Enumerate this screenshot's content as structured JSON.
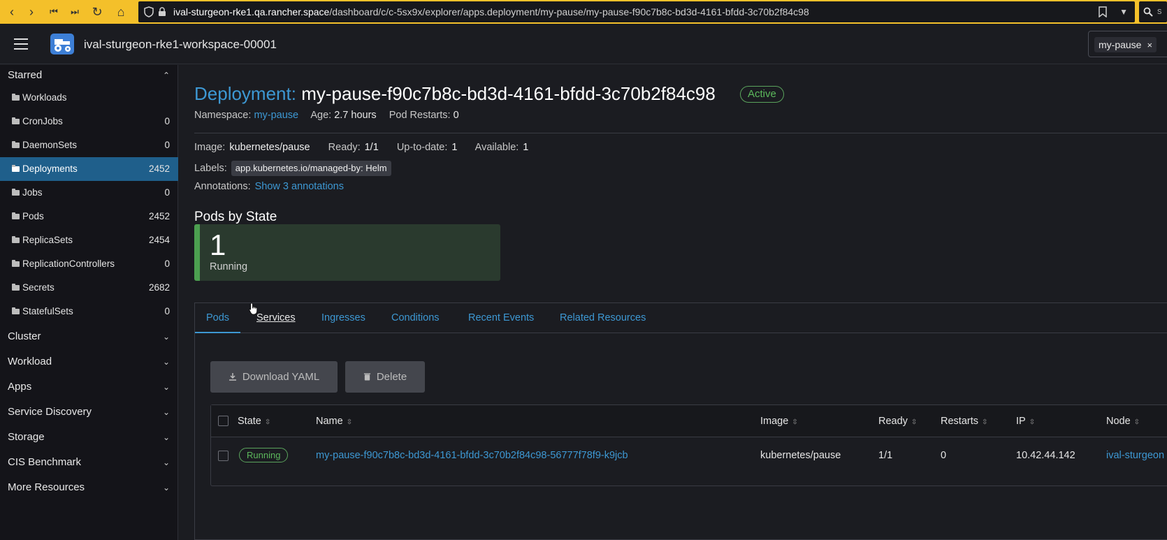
{
  "browser": {
    "url_host": "ival-sturgeon-rke1.qa.rancher.space",
    "url_path": "/dashboard/c/c-5sx9x/explorer/apps.deployment/my-pause/my-pause-f90c7b8c-bd3d-4161-bfdd-3c70b2f84c98",
    "search_text": "s"
  },
  "header": {
    "cluster_name": "ival-sturgeon-rke1-workspace-00001",
    "namespace_filter": "my-pause",
    "namespace_filter_close": "×"
  },
  "sidebar": {
    "starred_label": "Starred",
    "items": [
      {
        "label": "Workloads",
        "count": ""
      },
      {
        "label": "CronJobs",
        "count": "0"
      },
      {
        "label": "DaemonSets",
        "count": "0"
      },
      {
        "label": "Deployments",
        "count": "2452"
      },
      {
        "label": "Jobs",
        "count": "0"
      },
      {
        "label": "Pods",
        "count": "2452"
      },
      {
        "label": "ReplicaSets",
        "count": "2454"
      },
      {
        "label": "ReplicationControllers",
        "count": "0"
      },
      {
        "label": "Secrets",
        "count": "2682"
      },
      {
        "label": "StatefulSets",
        "count": "0"
      }
    ],
    "groups": [
      "Cluster",
      "Workload",
      "Apps",
      "Service Discovery",
      "Storage",
      "CIS Benchmark",
      "More Resources"
    ]
  },
  "detail": {
    "kind_label": "Deployment:",
    "name": "my-pause-f90c7b8c-bd3d-4161-bfdd-3c70b2f84c98",
    "state": "Active",
    "namespace_label": "Namespace:",
    "namespace": "my-pause",
    "age_label": "Age:",
    "age": "2.7 hours",
    "restarts_label": "Pod Restarts:",
    "restarts": "0",
    "image_label": "Image:",
    "image": "kubernetes/pause",
    "ready_label": "Ready:",
    "ready": "1/1",
    "uptodate_label": "Up-to-date:",
    "uptodate": "1",
    "available_label": "Available:",
    "available": "1",
    "labels_label": "Labels:",
    "label_chip": "app.kubernetes.io/managed-by: Helm",
    "annotations_label": "Annotations:",
    "annotations_link": "Show 3 annotations"
  },
  "pods_by_state": {
    "heading": "Pods by State",
    "count": "1",
    "state": "Running"
  },
  "tabs": [
    "Pods",
    "Services",
    "Ingresses",
    "Conditions",
    "Recent Events",
    "Related Resources"
  ],
  "actions": {
    "download": "Download YAML",
    "delete": "Delete"
  },
  "table": {
    "columns": [
      "State",
      "Name",
      "Image",
      "Ready",
      "Restarts",
      "IP",
      "Node"
    ],
    "rows": [
      {
        "state": "Running",
        "name": "my-pause-f90c7b8c-bd3d-4161-bfdd-3c70b2f84c98-56777f78f9-k9jcb",
        "image": "kubernetes/pause",
        "ready": "1/1",
        "restarts": "0",
        "ip": "10.42.44.142",
        "node": "ival-sturgeon"
      }
    ]
  },
  "colors": {
    "accent": "#3d98d3",
    "active_green": "#5cb85c",
    "sidebar_active": "#1f5f8b",
    "browser_bar": "#f4c02a"
  }
}
